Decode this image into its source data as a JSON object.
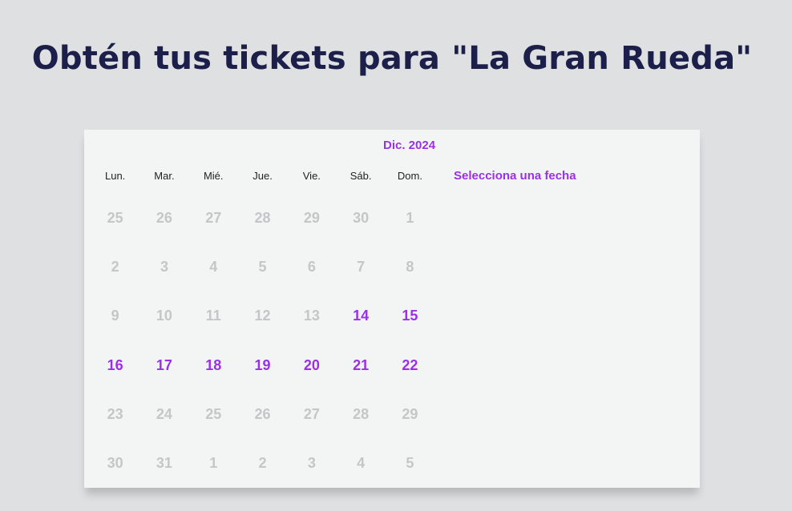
{
  "page": {
    "title": "Obtén tus tickets para \"La Gran Rueda\""
  },
  "calendar": {
    "month_label": "Dic. 2024",
    "select_hint": "Selecciona una fecha",
    "weekdays": [
      "Lun.",
      "Mar.",
      "Mié.",
      "Jue.",
      "Vie.",
      "Sáb.",
      "Dom."
    ],
    "weeks": [
      [
        {
          "label": "25",
          "available": false
        },
        {
          "label": "26",
          "available": false
        },
        {
          "label": "27",
          "available": false
        },
        {
          "label": "28",
          "available": false
        },
        {
          "label": "29",
          "available": false
        },
        {
          "label": "30",
          "available": false
        },
        {
          "label": "1",
          "available": false
        }
      ],
      [
        {
          "label": "2",
          "available": false
        },
        {
          "label": "3",
          "available": false
        },
        {
          "label": "4",
          "available": false
        },
        {
          "label": "5",
          "available": false
        },
        {
          "label": "6",
          "available": false
        },
        {
          "label": "7",
          "available": false
        },
        {
          "label": "8",
          "available": false
        }
      ],
      [
        {
          "label": "9",
          "available": false
        },
        {
          "label": "10",
          "available": false
        },
        {
          "label": "11",
          "available": false
        },
        {
          "label": "12",
          "available": false
        },
        {
          "label": "13",
          "available": false
        },
        {
          "label": "14",
          "available": true
        },
        {
          "label": "15",
          "available": true
        }
      ],
      [
        {
          "label": "16",
          "available": true
        },
        {
          "label": "17",
          "available": true
        },
        {
          "label": "18",
          "available": true
        },
        {
          "label": "19",
          "available": true
        },
        {
          "label": "20",
          "available": true
        },
        {
          "label": "21",
          "available": true
        },
        {
          "label": "22",
          "available": true
        }
      ],
      [
        {
          "label": "23",
          "available": false
        },
        {
          "label": "24",
          "available": false
        },
        {
          "label": "25",
          "available": false
        },
        {
          "label": "26",
          "available": false
        },
        {
          "label": "27",
          "available": false
        },
        {
          "label": "28",
          "available": false
        },
        {
          "label": "29",
          "available": false
        }
      ],
      [
        {
          "label": "30",
          "available": false
        },
        {
          "label": "31",
          "available": false
        },
        {
          "label": "1",
          "available": false
        },
        {
          "label": "2",
          "available": false
        },
        {
          "label": "3",
          "available": false
        },
        {
          "label": "4",
          "available": false
        },
        {
          "label": "5",
          "available": false
        }
      ]
    ]
  },
  "colors": {
    "title": "#1c1f49",
    "accent": "#9b30e8",
    "disabled_day": "#c4c6c7",
    "card_background": "#f3f5f4",
    "page_background": "#dfe0e2"
  }
}
